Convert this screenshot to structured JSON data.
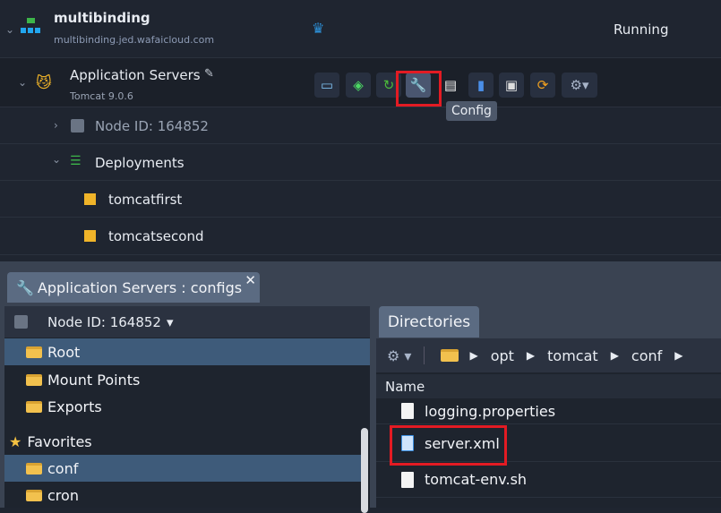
{
  "environment": {
    "name": "multibinding",
    "domain": "multibinding.jed.wafaicloud.com",
    "status": "Running",
    "icons": [
      "topology-icon",
      "crown-icon"
    ]
  },
  "app_servers": {
    "title": "Application Servers",
    "subtitle": "Tomcat 9.0.6",
    "toolbar": [
      "redeploy",
      "add-node",
      "restart",
      "config",
      "log",
      "statistics",
      "web-ssh",
      "refresh",
      "settings"
    ],
    "tooltip": "Config"
  },
  "node": {
    "label": "Node ID: 164852"
  },
  "deployments": {
    "label": "Deployments",
    "items": [
      "tomcatfirst",
      "tomcatsecond"
    ]
  },
  "bottom_tab": {
    "label": "Application Servers : configs"
  },
  "left_panel": {
    "node_selector": "Node ID: 164852",
    "items": [
      "Root",
      "Mount Points",
      "Exports"
    ],
    "favorites_label": "Favorites",
    "favorites": [
      "conf",
      "cron"
    ]
  },
  "right_panel": {
    "tab": "Directories",
    "breadcrumb": [
      "opt",
      "tomcat",
      "conf"
    ],
    "column": "Name",
    "files": [
      "logging.properties",
      "server.xml",
      "tomcat-env.sh"
    ]
  },
  "colors": {
    "highlight": "#e31b23",
    "selected": "#3e5b7a"
  }
}
